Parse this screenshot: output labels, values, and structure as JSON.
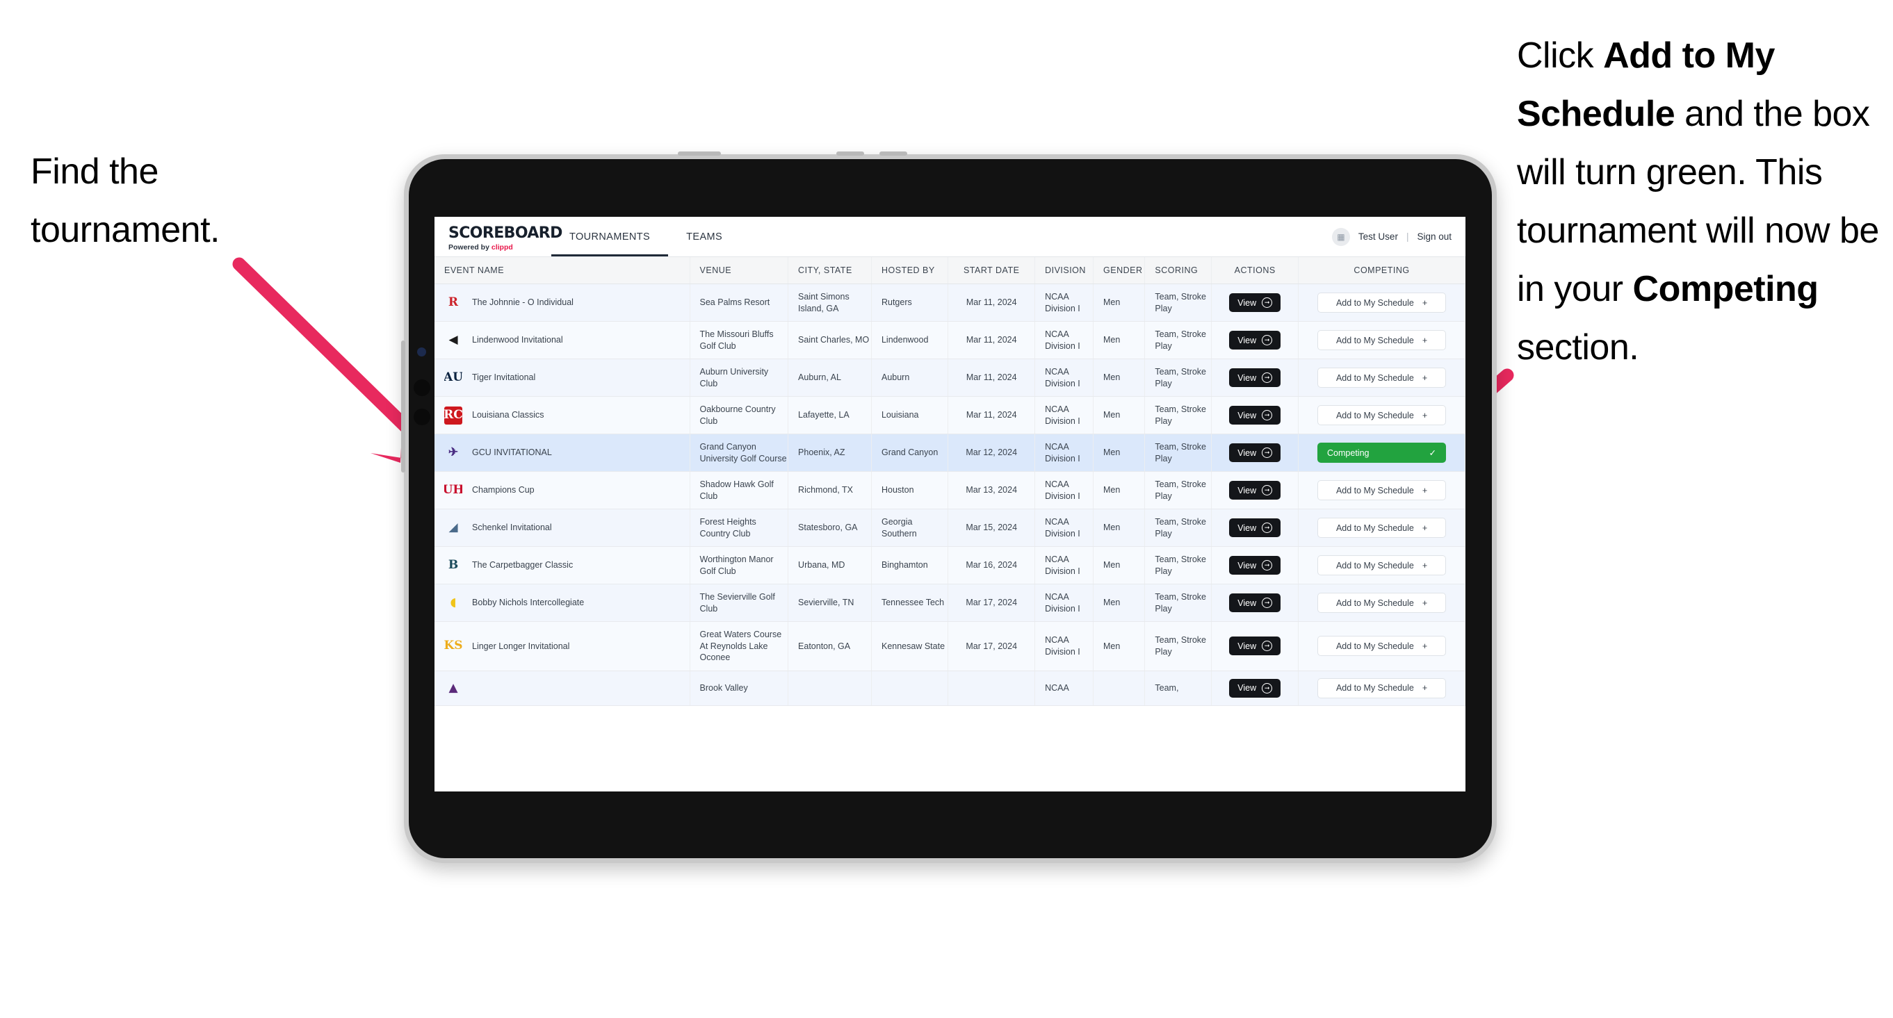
{
  "annotations": {
    "left": {
      "line1": "Find the",
      "line2": "tournament."
    },
    "right": {
      "part1": "Click ",
      "bold1": "Add to My Schedule",
      "part2": " and the box will turn green. This tournament will now be in your ",
      "bold2": "Competing",
      "part3": " section."
    },
    "arrow_color": "#e8295e"
  },
  "app": {
    "brand": {
      "title": "SCOREBOARD",
      "powered_prefix": "Powered by ",
      "powered_name": "clippd"
    },
    "nav": [
      {
        "label": "TOURNAMENTS",
        "active": true
      },
      {
        "label": "TEAMS",
        "active": false
      }
    ],
    "account": {
      "avatar_icon": "grid-icon",
      "user": "Test User",
      "separator": "|",
      "signout": "Sign out"
    },
    "table": {
      "columns": [
        "EVENT NAME",
        "VENUE",
        "CITY, STATE",
        "HOSTED BY",
        "START DATE",
        "DIVISION",
        "GENDER",
        "SCORING",
        "ACTIONS",
        "COMPETING"
      ],
      "action_label": "View",
      "add_label": "Add to My Schedule",
      "add_icon": "plus-icon",
      "competing_label": "Competing",
      "competing_icon": "check-icon",
      "view_icon": "arrow-right-circle-icon",
      "rows": [
        {
          "event": "The Johnnie - O Individual",
          "logo": {
            "text": "R",
            "color": "#cc2229",
            "bg": "transparent"
          },
          "venue": "Sea Palms Resort",
          "city": "Saint Simons Island, GA",
          "hosted_by": "Rutgers",
          "start_date": "Mar 11, 2024",
          "division": "NCAA Division I",
          "gender": "Men",
          "scoring": "Team, Stroke Play",
          "competing": false
        },
        {
          "event": "Lindenwood Invitational",
          "logo": {
            "text": "◀",
            "color": "#1b1b1b",
            "bg": "transparent"
          },
          "venue": "The Missouri Bluffs Golf Club",
          "city": "Saint Charles, MO",
          "hosted_by": "Lindenwood",
          "start_date": "Mar 11, 2024",
          "division": "NCAA Division I",
          "gender": "Men",
          "scoring": "Team, Stroke Play",
          "competing": false
        },
        {
          "event": "Tiger Invitational",
          "logo": {
            "text": "AU",
            "color": "#0c2340",
            "bg": "transparent"
          },
          "venue": "Auburn University Club",
          "city": "Auburn, AL",
          "hosted_by": "Auburn",
          "start_date": "Mar 11, 2024",
          "division": "NCAA Division I",
          "gender": "Men",
          "scoring": "Team, Stroke Play",
          "competing": false
        },
        {
          "event": "Louisiana Classics",
          "logo": {
            "text": "RC",
            "color": "#ffffff",
            "bg": "#ce181e"
          },
          "venue": "Oakbourne Country Club",
          "city": "Lafayette, LA",
          "hosted_by": "Louisiana",
          "start_date": "Mar 11, 2024",
          "division": "NCAA Division I",
          "gender": "Men",
          "scoring": "Team, Stroke Play",
          "competing": false
        },
        {
          "event": "GCU INVITATIONAL",
          "logo": {
            "text": "✈",
            "color": "#4b2e83",
            "bg": "transparent"
          },
          "venue": "Grand Canyon University Golf Course",
          "city": "Phoenix, AZ",
          "hosted_by": "Grand Canyon",
          "start_date": "Mar 12, 2024",
          "division": "NCAA Division I",
          "gender": "Men",
          "scoring": "Team, Stroke Play",
          "competing": true,
          "selected": true
        },
        {
          "event": "Champions Cup",
          "logo": {
            "text": "UH",
            "color": "#c8102e",
            "bg": "transparent"
          },
          "venue": "Shadow Hawk Golf Club",
          "city": "Richmond, TX",
          "hosted_by": "Houston",
          "start_date": "Mar 13, 2024",
          "division": "NCAA Division I",
          "gender": "Men",
          "scoring": "Team, Stroke Play",
          "competing": false
        },
        {
          "event": "Schenkel Invitational",
          "logo": {
            "text": "◢",
            "color": "#4a6a8a",
            "bg": "transparent"
          },
          "venue": "Forest Heights Country Club",
          "city": "Statesboro, GA",
          "hosted_by": "Georgia Southern",
          "start_date": "Mar 15, 2024",
          "division": "NCAA Division I",
          "gender": "Men",
          "scoring": "Team, Stroke Play",
          "competing": false
        },
        {
          "event": "The Carpetbagger Classic",
          "logo": {
            "text": "B",
            "color": "#1b4a5a",
            "bg": "transparent"
          },
          "venue": "Worthington Manor Golf Club",
          "city": "Urbana, MD",
          "hosted_by": "Binghamton",
          "start_date": "Mar 16, 2024",
          "division": "NCAA Division I",
          "gender": "Men",
          "scoring": "Team, Stroke Play",
          "competing": false
        },
        {
          "event": "Bobby Nichols Intercollegiate",
          "logo": {
            "text": "◖",
            "color": "#f0c419",
            "bg": "transparent"
          },
          "venue": "The Sevierville Golf Club",
          "city": "Sevierville, TN",
          "hosted_by": "Tennessee Tech",
          "start_date": "Mar 17, 2024",
          "division": "NCAA Division I",
          "gender": "Men",
          "scoring": "Team, Stroke Play",
          "competing": false
        },
        {
          "event": "Linger Longer Invitational",
          "logo": {
            "text": "KS",
            "color": "#edac1a",
            "bg": "transparent"
          },
          "venue": "Great Waters Course At Reynolds Lake Oconee",
          "city": "Eatonton, GA",
          "hosted_by": "Kennesaw State",
          "start_date": "Mar 17, 2024",
          "division": "NCAA Division I",
          "gender": "Men",
          "scoring": "Team, Stroke Play",
          "competing": false
        },
        {
          "event": "",
          "logo": {
            "text": "▲",
            "color": "#5b2a7a",
            "bg": "transparent"
          },
          "venue": "Brook Valley",
          "city": "",
          "hosted_by": "",
          "start_date": "",
          "division": "NCAA",
          "gender": "",
          "scoring": "Team,",
          "competing": false,
          "partial": true
        }
      ]
    }
  }
}
